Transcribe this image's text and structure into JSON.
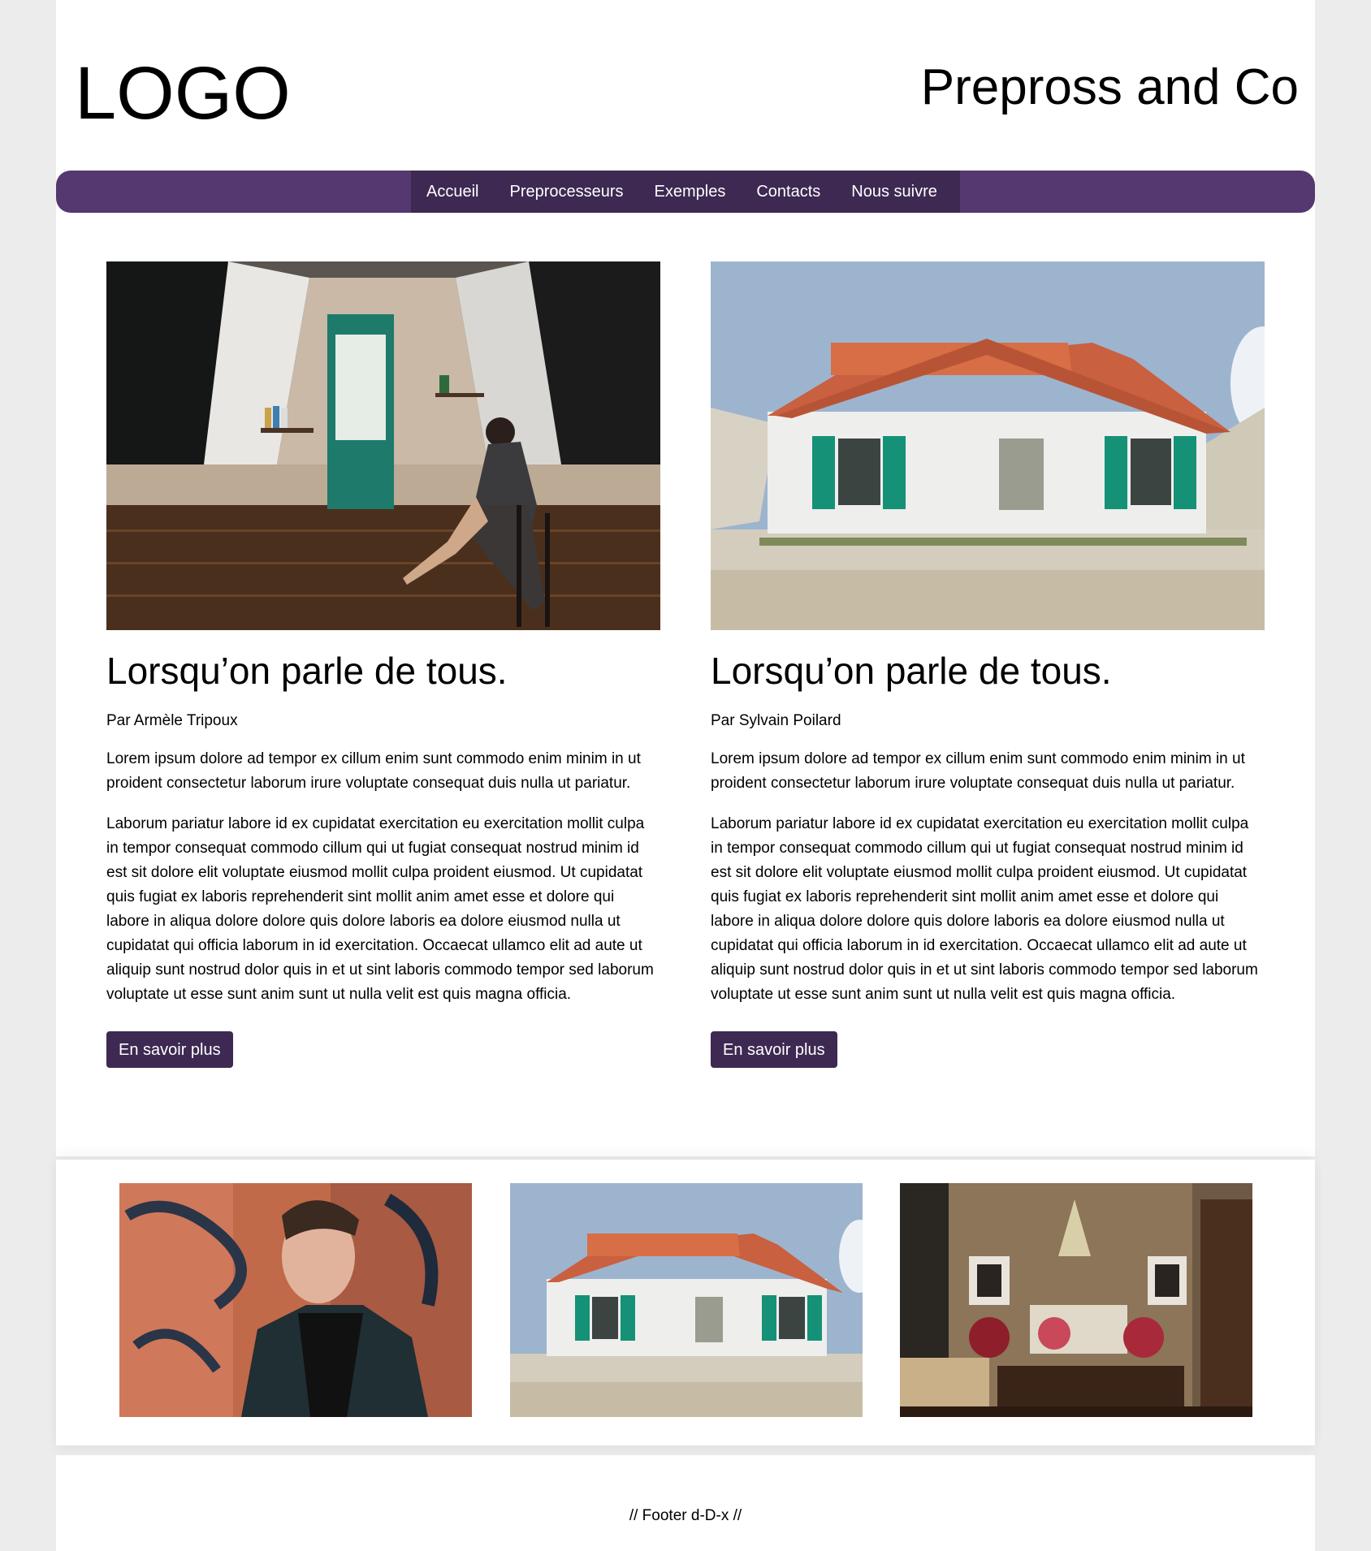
{
  "header": {
    "logo": "LOGO",
    "site_title": "Prepross and Co"
  },
  "nav": {
    "items": [
      "Accueil",
      "Preprocesseurs",
      "Exemples",
      "Contacts",
      "Nous suivre"
    ]
  },
  "colors": {
    "nav_bar": "#55386f",
    "nav_inner": "#3d2952",
    "button": "#3d2952",
    "page_bg": "#ececec"
  },
  "articles": [
    {
      "image": "attic-room-woman-reading-photo",
      "title": "Lorsqu’on parle de tous.",
      "author": "Par Armèle Tripoux",
      "p1": "Lorem ipsum dolore ad tempor ex cillum enim sunt commodo enim minim in ut proident consectetur laborum irure voluptate consequat duis nulla ut pariatur.",
      "p2": "Laborum pariatur labore id ex cupidatat exercitation eu exercitation mollit culpa in tempor consequat commodo cillum qui ut fugiat consequat nostrud minim id est sit dolore elit voluptate eiusmod mollit culpa proident eiusmod. Ut cupidatat quis fugiat ex laboris reprehenderit sint mollit anim amet esse et dolore qui labore in aliqua dolore dolore quis dolore laboris ea dolore eiusmod nulla ut cupidatat qui officia laborum in id exercitation. Occaecat ullamco elit ad aute ut aliquip sunt nostrud dolor quis in et ut sint laboris commodo tempor sed laborum voluptate ut esse sunt anim sunt ut nulla velit est quis magna officia.",
      "button": "En savoir plus"
    },
    {
      "image": "white-house-green-shutters-photo",
      "title": "Lorsqu’on parle de tous.",
      "author": "Par Sylvain Poilard",
      "p1": "Lorem ipsum dolore ad tempor ex cillum enim sunt commodo enim minim in ut proident consectetur laborum irure voluptate consequat duis nulla ut pariatur.",
      "p2": "Laborum pariatur labore id ex cupidatat exercitation eu exercitation mollit culpa in tempor consequat commodo cillum qui ut fugiat consequat nostrud minim id est sit dolore elit voluptate eiusmod mollit culpa proident eiusmod. Ut cupidatat quis fugiat ex laboris reprehenderit sint mollit anim amet esse et dolore qui labore in aliqua dolore dolore quis dolore laboris ea dolore eiusmod nulla ut cupidatat qui officia laborum in id exercitation. Occaecat ullamco elit ad aute ut aliquip sunt nostrud dolor quis in et ut sint laboris commodo tempor sed laborum voluptate ut esse sunt anim sunt ut nulla velit est quis magna officia.",
      "button": "En savoir plus"
    }
  ],
  "gallery": [
    "man-leather-jacket-graffiti-photo",
    "white-house-green-shutters-photo",
    "living-room-chandelier-flowers-photo"
  ],
  "footer": {
    "text": "// Footer d-D-x //"
  }
}
